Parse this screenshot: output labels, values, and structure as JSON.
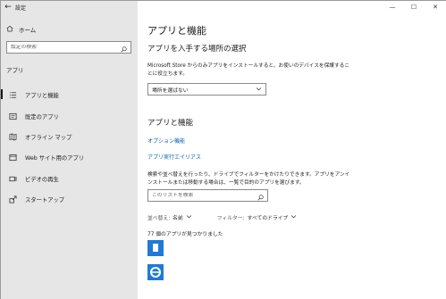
{
  "window": {
    "title": "設定",
    "back_glyph": "←",
    "minimize": "—",
    "maximize": "☐",
    "close": "✕"
  },
  "sidebar": {
    "home_label": "ホーム",
    "search_placeholder": "設定の検索",
    "section": "アプリ",
    "items": [
      {
        "label": "アプリと機能",
        "icon": "list-icon",
        "active": true
      },
      {
        "label": "既定のアプリ",
        "icon": "default-apps-icon",
        "active": false
      },
      {
        "label": "オフライン マップ",
        "icon": "map-icon",
        "active": false
      },
      {
        "label": "Web サイト用のアプリ",
        "icon": "web-icon",
        "active": false
      },
      {
        "label": "ビデオの再生",
        "icon": "video-icon",
        "active": false
      },
      {
        "label": "スタートアップ",
        "icon": "startup-icon",
        "active": false
      }
    ]
  },
  "main": {
    "title": "アプリと機能",
    "acquire_heading": "アプリを入手する場所の選択",
    "acquire_desc": "Microsoft Store からのみアプリをインストールすると、お使いのデバイスを保護することに役立ちます。",
    "source_dropdown": "場所を選ばない",
    "features_heading": "アプリと機能",
    "optional_features_link": "オプション機能",
    "app_alias_link": "アプリ実行エイリアス",
    "list_desc": "検索や並べ替えを行ったり、ドライブでフィルターをかけたりできます。アプリをアンインストールまたは移動する場合は、一覧で目的のアプリを選びます。",
    "list_search_placeholder": "このリストを検索",
    "sort_label": "並べ替え:",
    "sort_value": "名前",
    "filter_label": "フィルター:",
    "filter_value": "すべてのドライブ",
    "count_text": "77 個のアプリが見つかりました"
  },
  "colors": {
    "accent": "#0a63b4",
    "sidebar_bg": "#e6e6e6",
    "app_icon_blue": "#1f7ad6"
  }
}
